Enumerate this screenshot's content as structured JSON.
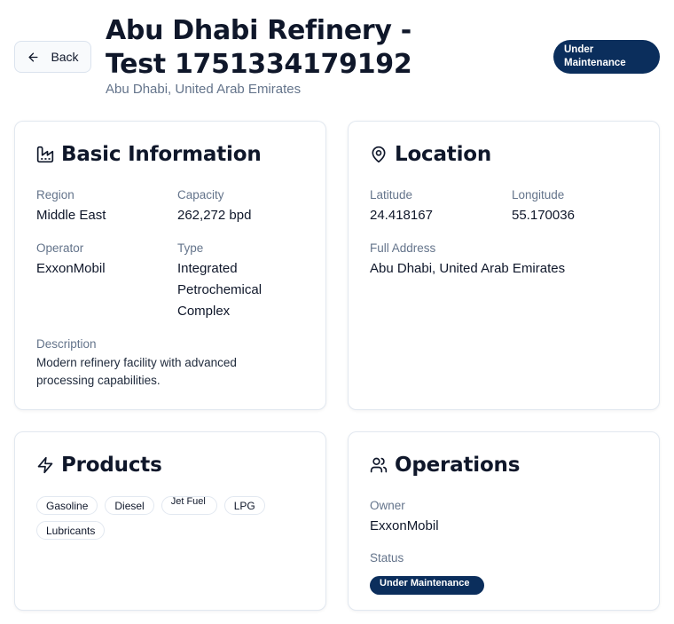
{
  "header": {
    "back_label": "Back",
    "title": "Abu Dhabi Refinery - Test 1751334179192",
    "subtitle": "Abu Dhabi, United Arab Emirates",
    "status": "Under Maintenance",
    "status_color": "#0b2e5c"
  },
  "basic_info": {
    "title": "Basic Information",
    "icon": "factory-icon",
    "region_label": "Region",
    "region": "Middle East",
    "capacity_label": "Capacity",
    "capacity": "262,272 bpd",
    "operator_label": "Operator",
    "operator": "ExxonMobil",
    "type_label": "Type",
    "type": "Integrated Petrochemical Complex",
    "description_label": "Description",
    "description": "Modern refinery facility with advanced processing capabilities."
  },
  "location": {
    "title": "Location",
    "icon": "map-pin-icon",
    "latitude_label": "Latitude",
    "latitude": "24.418167",
    "longitude_label": "Longitude",
    "longitude": "55.170036",
    "address_label": "Full Address",
    "address": "Abu Dhabi, United Arab Emirates"
  },
  "products": {
    "title": "Products",
    "icon": "zap-icon",
    "items": [
      "Gasoline",
      "Diesel",
      "Jet Fuel",
      "LPG",
      "Lubricants"
    ]
  },
  "operations": {
    "title": "Operations",
    "icon": "users-icon",
    "owner_label": "Owner",
    "owner": "ExxonMobil",
    "status_label": "Status",
    "status": "Under Maintenance"
  }
}
